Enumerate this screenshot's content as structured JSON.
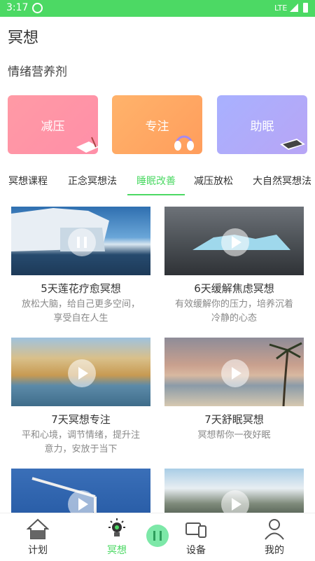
{
  "status_bar": {
    "time": "3:17",
    "network": "LTE"
  },
  "page": {
    "title": "冥想",
    "subtitle": "情绪营养剂"
  },
  "categories": [
    {
      "label": "减压",
      "color": "#ff95a6"
    },
    {
      "label": "专注",
      "color": "#ffa762"
    },
    {
      "label": "助眠",
      "color": "#aeadfc"
    }
  ],
  "tabs": [
    {
      "label": "冥想课程"
    },
    {
      "label": "正念冥想法"
    },
    {
      "label": "睡眠改善"
    },
    {
      "label": "减压放松"
    },
    {
      "label": "大自然冥想法"
    }
  ],
  "active_tab": "睡眠改善",
  "courses": [
    {
      "title": "5天莲花疗愈冥想",
      "desc": [
        "放松大脑，给自己更多空间，",
        "享受自在人生"
      ]
    },
    {
      "title": "6天缓解焦虑冥想",
      "desc": [
        "有效缓解你的压力，培养沉着",
        "冷静的心态"
      ]
    },
    {
      "title": "7天冥想专注",
      "desc": [
        "平和心境，调节情绪，提升注",
        "意力，安放于当下"
      ]
    },
    {
      "title": "7天舒眠冥想",
      "desc": [
        "冥想帮你一夜好眠",
        ""
      ]
    },
    {
      "title": "",
      "desc": [
        "",
        ""
      ]
    },
    {
      "title": "",
      "desc": [
        "",
        ""
      ]
    }
  ],
  "bottom_nav": [
    {
      "label": "计划",
      "icon": "house-icon"
    },
    {
      "label": "冥想",
      "icon": "lightbulb-icon"
    },
    {
      "label": "设备",
      "icon": "devices-icon"
    },
    {
      "label": "我的",
      "icon": "person-icon"
    }
  ],
  "colors": {
    "accent": "#4cd964",
    "status_bar": "#4cd964"
  }
}
